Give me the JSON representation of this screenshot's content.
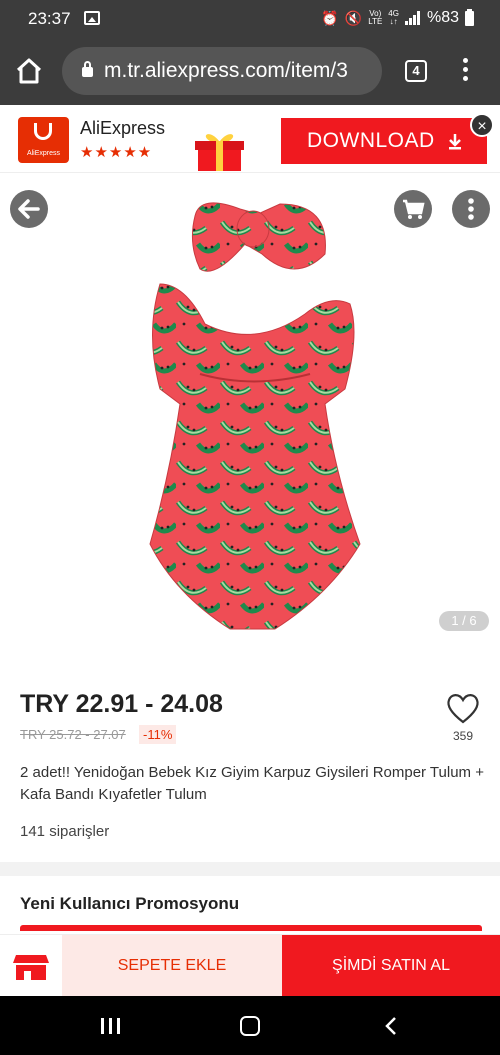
{
  "status_bar": {
    "time": "23:37",
    "battery": "%83",
    "net_top": "Vo)",
    "net_bottom": "LTE",
    "net2_top": "4G",
    "net2_bottom": "↓↑"
  },
  "browser": {
    "url": "m.tr.aliexpress.com/item/3",
    "tab_count": "4"
  },
  "app_banner": {
    "app_name": "AliExpress",
    "logo_text": "AliExpress",
    "stars": "★★★★★",
    "download_label": "DOWNLOAD",
    "close": "×"
  },
  "gallery": {
    "page_indicator": "1 / 6"
  },
  "product": {
    "price": "TRY 22.91 - 24.08",
    "old_price": "TRY 25.72 - 27.07",
    "discount": "-11%",
    "wishlist_count": "359",
    "title": "2 adet!! Yenidoğan Bebek Kız Giyim Karpuz Giysileri Romper Tulum + Kafa Bandı Kıyafetler Tulum",
    "orders": "141  siparişler"
  },
  "promo": {
    "title": "Yeni Kullanıcı Promosyonu"
  },
  "bottom_bar": {
    "add_to_cart": "SEPETE EKLE",
    "buy_now": "ŞİMDİ SATIN AL"
  },
  "colors": {
    "accent": "#f0191f",
    "brand": "#e62e04",
    "chrome": "#3c3c3c"
  }
}
